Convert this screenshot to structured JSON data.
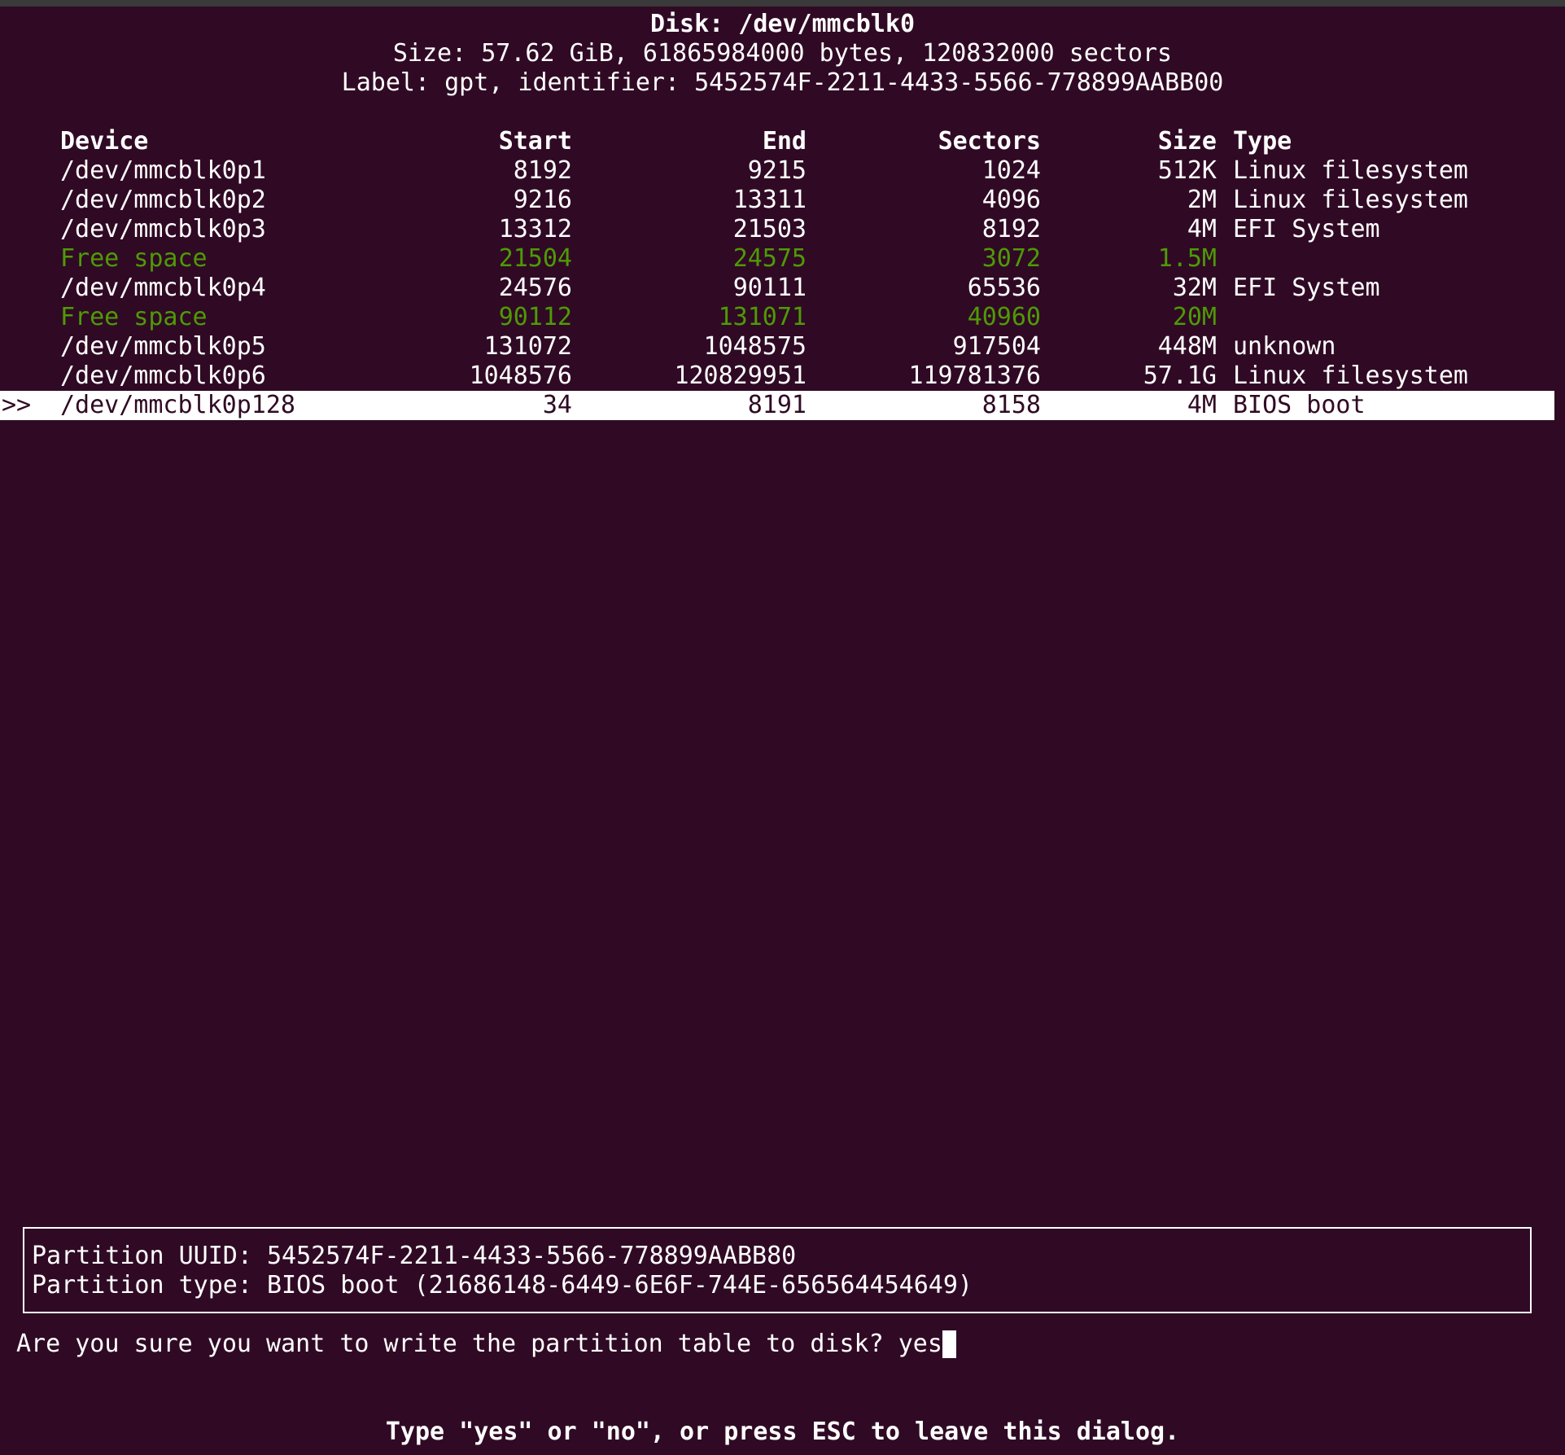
{
  "header": {
    "disk": "Disk: /dev/mmcblk0",
    "size": "Size: 57.62 GiB, 61865984000 bytes, 120832000 sectors",
    "label": "Label: gpt, identifier: 5452574F-2211-4433-5566-778899AABB00"
  },
  "table": {
    "columns": {
      "device": "Device",
      "start": "Start",
      "end": "End",
      "sectors": "Sectors",
      "size": "Size",
      "type": "Type"
    },
    "rows": [
      {
        "marker": "",
        "device": "/dev/mmcblk0p1",
        "start": "8192",
        "end": "9215",
        "sectors": "1024",
        "size": "512K",
        "type": "Linux filesystem",
        "kind": "partition"
      },
      {
        "marker": "",
        "device": "/dev/mmcblk0p2",
        "start": "9216",
        "end": "13311",
        "sectors": "4096",
        "size": "2M",
        "type": "Linux filesystem",
        "kind": "partition"
      },
      {
        "marker": "",
        "device": "/dev/mmcblk0p3",
        "start": "13312",
        "end": "21503",
        "sectors": "8192",
        "size": "4M",
        "type": "EFI System",
        "kind": "partition"
      },
      {
        "marker": "",
        "device": "Free space",
        "start": "21504",
        "end": "24575",
        "sectors": "3072",
        "size": "1.5M",
        "type": "",
        "kind": "free"
      },
      {
        "marker": "",
        "device": "/dev/mmcblk0p4",
        "start": "24576",
        "end": "90111",
        "sectors": "65536",
        "size": "32M",
        "type": "EFI System",
        "kind": "partition"
      },
      {
        "marker": "",
        "device": "Free space",
        "start": "90112",
        "end": "131071",
        "sectors": "40960",
        "size": "20M",
        "type": "",
        "kind": "free"
      },
      {
        "marker": "",
        "device": "/dev/mmcblk0p5",
        "start": "131072",
        "end": "1048575",
        "sectors": "917504",
        "size": "448M",
        "type": "unknown",
        "kind": "partition"
      },
      {
        "marker": "",
        "device": "/dev/mmcblk0p6",
        "start": "1048576",
        "end": "120829951",
        "sectors": "119781376",
        "size": "57.1G",
        "type": "Linux filesystem",
        "kind": "partition"
      },
      {
        "marker": ">>",
        "device": "/dev/mmcblk0p128",
        "start": "34",
        "end": "8191",
        "sectors": "8158",
        "size": "4M",
        "type": "BIOS boot",
        "kind": "selected"
      }
    ]
  },
  "info": {
    "uuid": "Partition UUID: 5452574F-2211-4433-5566-778899AABB80",
    "type": "Partition type: BIOS boot (21686148-6449-6E6F-744E-656564454649)"
  },
  "prompt": {
    "question": "Are you sure you want to write the partition table to disk? ",
    "input_value": "yes"
  },
  "hint": "Type \"yes\" or \"no\", or press ESC to leave this dialog.",
  "colors": {
    "background": "#300a24",
    "foreground": "#ffffff",
    "free_space": "#4e9a06"
  }
}
